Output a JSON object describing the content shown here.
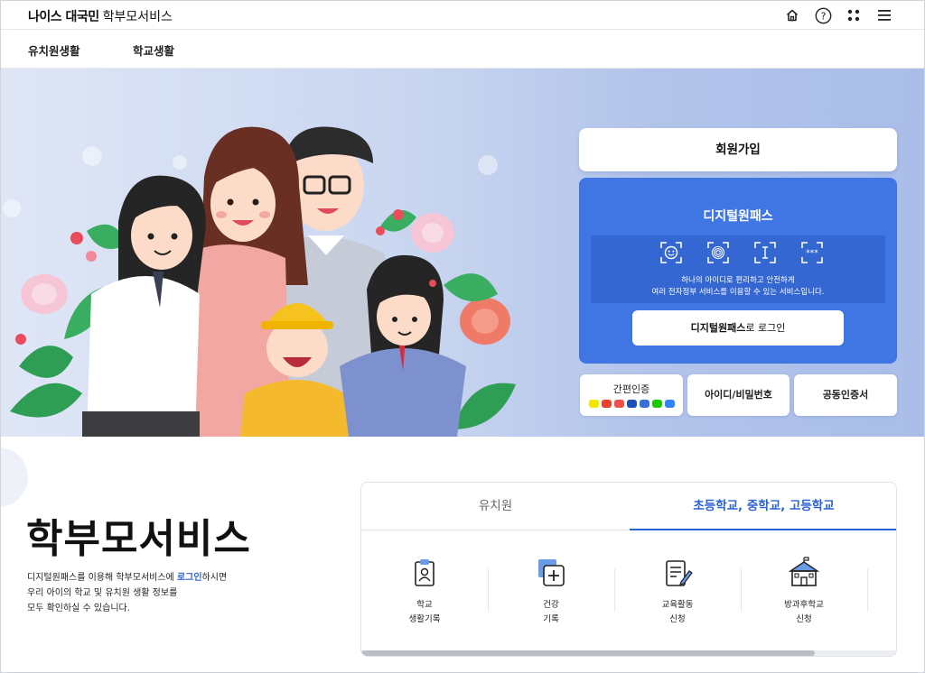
{
  "header": {
    "brand": "나이스 대국민",
    "service": "학부모서비스",
    "icons": [
      "home-icon",
      "help-icon",
      "apps-grid-icon",
      "menu-icon"
    ]
  },
  "nav": {
    "items": [
      {
        "label": "유치원생활"
      },
      {
        "label": "학교생활"
      }
    ]
  },
  "login": {
    "join_label": "회원가입",
    "digital_pass": {
      "title": "디지털원패스",
      "icons": [
        "face-icon",
        "fingerprint-icon",
        "pattern-icon",
        "password-icon"
      ],
      "desc_line1": "하나의 아이디로 편리하고 안전하게",
      "desc_line2": "여러 전자정부 서비스를 이용할 수 있는 서비스입니다.",
      "login_bold": "디지털원패스",
      "login_rest": "로 로그인"
    },
    "simple_auth": {
      "label": "간편인증",
      "providers": [
        {
          "name": "kakao-icon",
          "color": "#f7e600"
        },
        {
          "name": "pass-icon",
          "color": "#e8412c"
        },
        {
          "name": "payco-icon",
          "color": "#f24e4e"
        },
        {
          "name": "samsung-pass-icon",
          "color": "#1c4fb8"
        },
        {
          "name": "kb-icon",
          "color": "#3a6fd8"
        },
        {
          "name": "naver-icon",
          "color": "#1ec800"
        },
        {
          "name": "toss-icon",
          "color": "#3182f6"
        }
      ]
    },
    "id_password_label": "아이디/비밀번호",
    "certificate_label": "공동인증서"
  },
  "intro": {
    "title": "학부모서비스",
    "desc_pre": "디지털원패스를 이용해 학부모서비스에 ",
    "desc_link": "로그인",
    "desc_post": "하시면",
    "desc_line2": "우리 아이의 학교 및 유치원 생활 정보를",
    "desc_line3": "모두 확인하실 수 있습니다."
  },
  "services": {
    "tabs": [
      {
        "label": "유치원",
        "active": false
      },
      {
        "label": "초등학교, 중학교, 고등학교",
        "active": true
      }
    ],
    "items": [
      {
        "line1": "학교",
        "line2": "생활기록",
        "icon": "school-record-icon"
      },
      {
        "line1": "건강",
        "line2": "기록",
        "icon": "health-record-icon"
      },
      {
        "line1": "교육활동",
        "line2": "신청",
        "icon": "activity-apply-icon"
      },
      {
        "line1": "방과후학교",
        "line2": "신청",
        "icon": "afterschool-icon"
      }
    ]
  },
  "colors": {
    "accent": "#2c62d8",
    "digital_pass_bg": "#3f76e4",
    "hero_bg": "#c9d6f0"
  }
}
